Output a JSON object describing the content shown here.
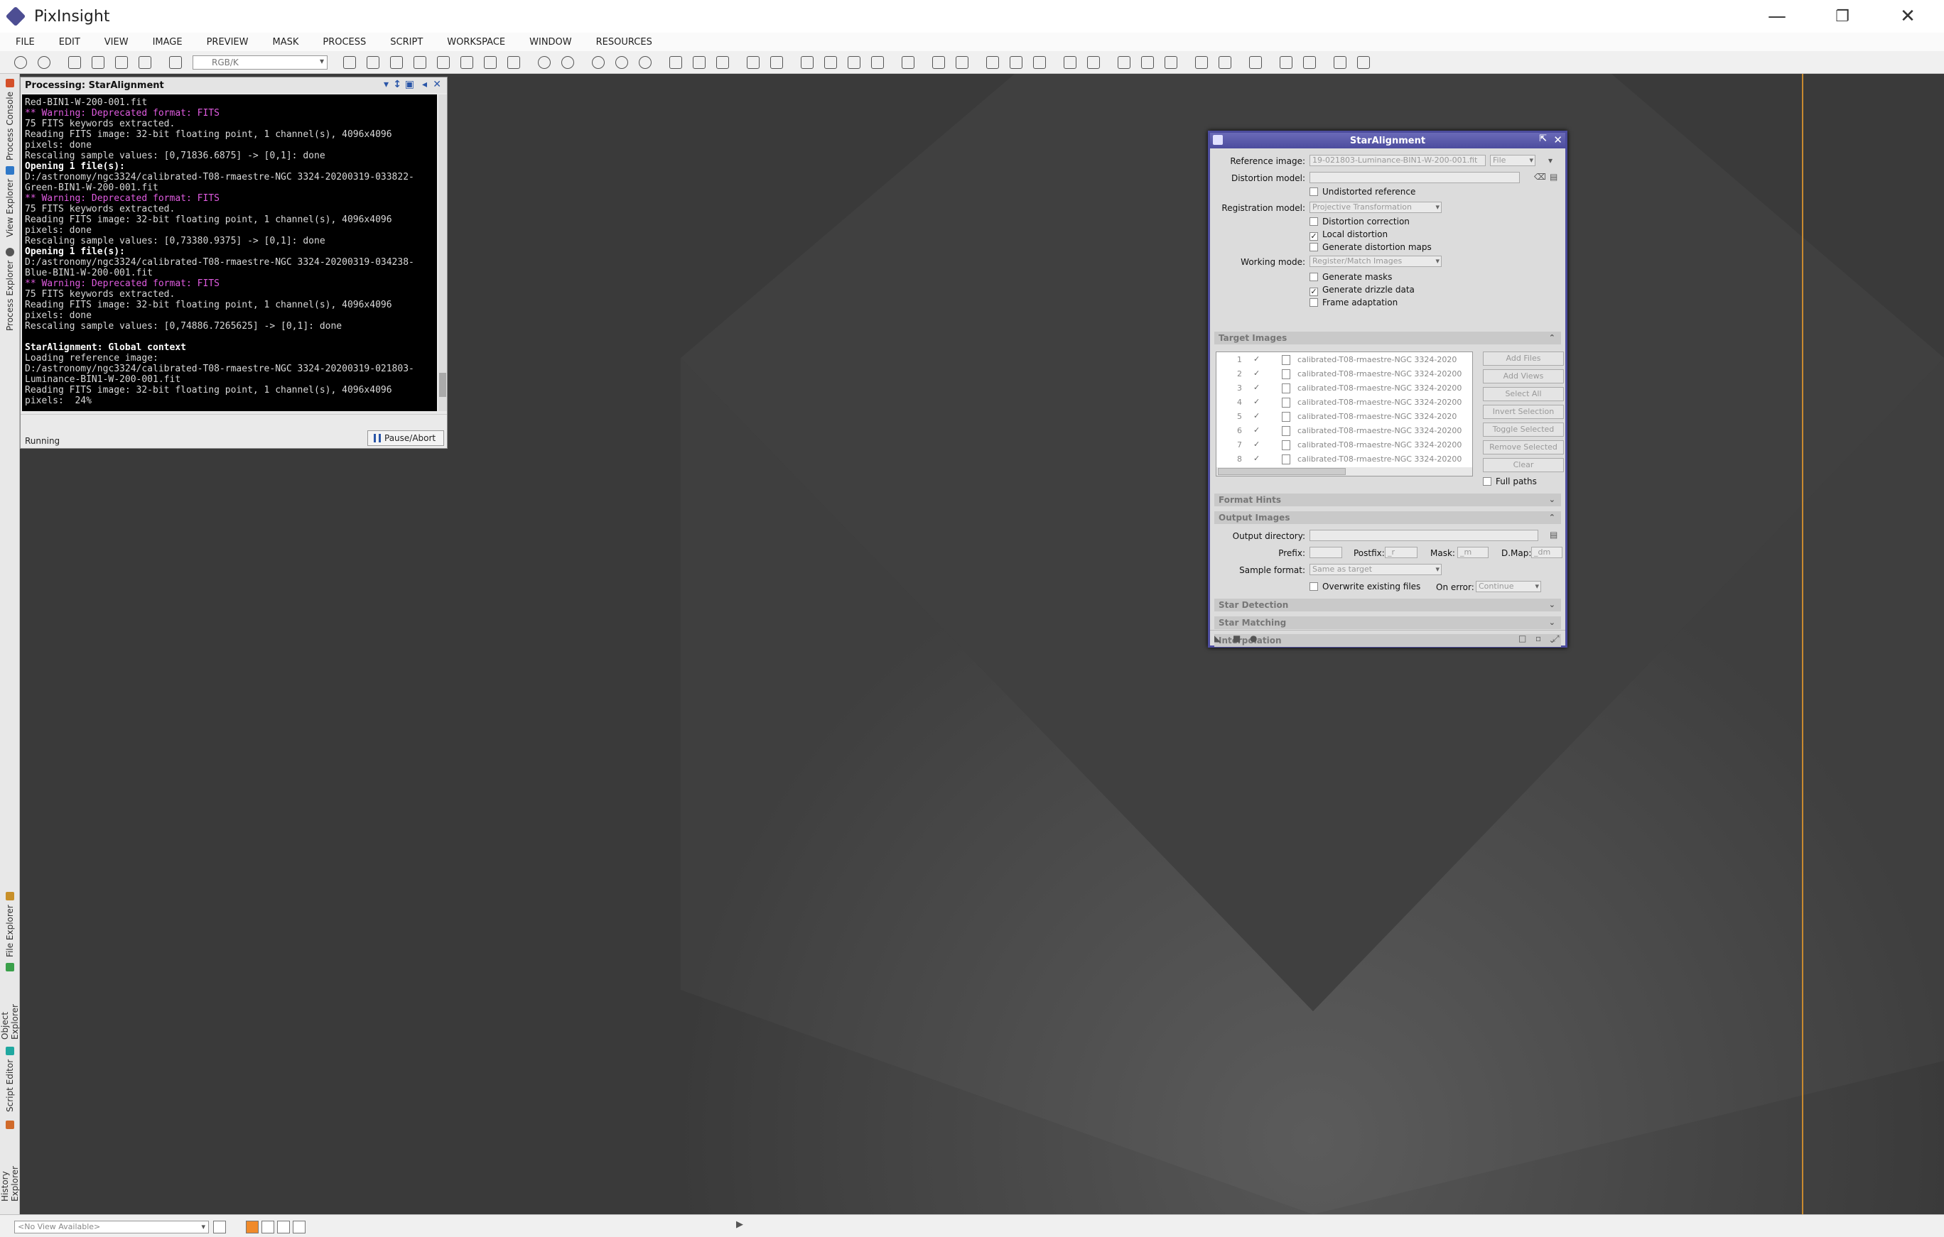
{
  "app": {
    "title": "PixInsight",
    "win_min": "—",
    "win_restore": "❐",
    "win_close": "✕"
  },
  "menu": [
    "FILE",
    "EDIT",
    "VIEW",
    "IMAGE",
    "PREVIEW",
    "MASK",
    "PROCESS",
    "SCRIPT",
    "WORKSPACE",
    "WINDOW",
    "RESOURCES"
  ],
  "toolbar": {
    "rgb_combo": "RGB/K"
  },
  "sidebar": {
    "tabs": [
      "Process Console",
      "View Explorer",
      "Process Explorer",
      "File Explorer",
      "Object Explorer",
      "Script Editor",
      "History Explorer"
    ]
  },
  "console": {
    "title": "Processing: StarAlignment",
    "lines": [
      {
        "t": "Red-BIN1-W-200-001.fit",
        "s": ""
      },
      {
        "t": "** Warning: Deprecated format: FITS",
        "s": "m"
      },
      {
        "t": "75 FITS keywords extracted.",
        "s": ""
      },
      {
        "t": "Reading FITS image: 32-bit floating point, 1 channel(s), 4096x4096",
        "s": ""
      },
      {
        "t": "pixels: done",
        "s": ""
      },
      {
        "t": "Rescaling sample values: [0,71836.6875] -> [0,1]: done",
        "s": ""
      },
      {
        "t": "Opening 1 file(s):",
        "s": "b"
      },
      {
        "t": "D:/astronomy/ngc3324/calibrated-T08-rmaestre-NGC 3324-20200319-033822-",
        "s": ""
      },
      {
        "t": "Green-BIN1-W-200-001.fit",
        "s": ""
      },
      {
        "t": "** Warning: Deprecated format: FITS",
        "s": "m"
      },
      {
        "t": "75 FITS keywords extracted.",
        "s": ""
      },
      {
        "t": "Reading FITS image: 32-bit floating point, 1 channel(s), 4096x4096",
        "s": ""
      },
      {
        "t": "pixels: done",
        "s": ""
      },
      {
        "t": "Rescaling sample values: [0,73380.9375] -> [0,1]: done",
        "s": ""
      },
      {
        "t": "Opening 1 file(s):",
        "s": "b"
      },
      {
        "t": "D:/astronomy/ngc3324/calibrated-T08-rmaestre-NGC 3324-20200319-034238-",
        "s": ""
      },
      {
        "t": "Blue-BIN1-W-200-001.fit",
        "s": ""
      },
      {
        "t": "** Warning: Deprecated format: FITS",
        "s": "m"
      },
      {
        "t": "75 FITS keywords extracted.",
        "s": ""
      },
      {
        "t": "Reading FITS image: 32-bit floating point, 1 channel(s), 4096x4096",
        "s": ""
      },
      {
        "t": "pixels: done",
        "s": ""
      },
      {
        "t": "Rescaling sample values: [0,74886.7265625] -> [0,1]: done",
        "s": ""
      },
      {
        "t": "",
        "s": ""
      },
      {
        "t": "StarAlignment: Global context",
        "s": "b"
      },
      {
        "t": "Loading reference image:",
        "s": ""
      },
      {
        "t": "D:/astronomy/ngc3324/calibrated-T08-rmaestre-NGC 3324-20200319-021803-",
        "s": ""
      },
      {
        "t": "Luminance-BIN1-W-200-001.fit",
        "s": ""
      },
      {
        "t": "Reading FITS image: 32-bit floating point, 1 channel(s), 4096x4096",
        "s": ""
      },
      {
        "t": "pixels:  24%",
        "s": ""
      }
    ],
    "status": "Running",
    "pause_label": "Pause/Abort"
  },
  "star_alignment": {
    "title": "StarAlignment",
    "reference_image_label": "Reference image:",
    "reference_image_value": "19-021803-Luminance-BIN1-W-200-001.fit",
    "reference_mode": "File",
    "distortion_model_label": "Distortion model:",
    "distortion_model_value": "",
    "undistorted_reference": "Undistorted reference",
    "registration_model_label": "Registration model:",
    "registration_model_value": "Projective Transformation",
    "distortion_correction": "Distortion correction",
    "local_distortion": "Local distortion",
    "generate_distortion_maps": "Generate distortion maps",
    "working_mode_label": "Working mode:",
    "working_mode_value": "Register/Match Images",
    "generate_masks": "Generate masks",
    "generate_drizzle": "Generate drizzle data",
    "frame_adaptation": "Frame adaptation",
    "checks": {
      "undistorted": false,
      "distortion_correction": false,
      "local_distortion": true,
      "distortion_maps": false,
      "masks": false,
      "drizzle": true,
      "frame_adaptation": false,
      "full_paths": false,
      "overwrite": false
    },
    "target_images_section": "Target Images",
    "targets": [
      {
        "n": "1",
        "name": "calibrated-T08-rmaestre-NGC 3324-2020"
      },
      {
        "n": "2",
        "name": "calibrated-T08-rmaestre-NGC 3324-20200"
      },
      {
        "n": "3",
        "name": "calibrated-T08-rmaestre-NGC 3324-20200"
      },
      {
        "n": "4",
        "name": "calibrated-T08-rmaestre-NGC 3324-20200"
      },
      {
        "n": "5",
        "name": "calibrated-T08-rmaestre-NGC 3324-2020"
      },
      {
        "n": "6",
        "name": "calibrated-T08-rmaestre-NGC 3324-20200"
      },
      {
        "n": "7",
        "name": "calibrated-T08-rmaestre-NGC 3324-20200"
      },
      {
        "n": "8",
        "name": "calibrated-T08-rmaestre-NGC 3324-20200"
      }
    ],
    "target_buttons": [
      "Add Files",
      "Add Views",
      "Select All",
      "Invert Selection",
      "Toggle Selected",
      "Remove Selected",
      "Clear"
    ],
    "full_paths": "Full paths",
    "format_hints_section": "Format Hints",
    "output_images_section": "Output Images",
    "output_directory_label": "Output directory:",
    "output_directory_value": "",
    "prefix_label": "Prefix:",
    "prefix_value": "",
    "postfix_label": "Postfix:",
    "postfix_value": "_r",
    "mask_label": "Mask:",
    "mask_value": "_m",
    "dmap_label": "D.Map:",
    "dmap_value": "_dm",
    "sample_format_label": "Sample format:",
    "sample_format_value": "Same as target",
    "overwrite_label": "Overwrite existing files",
    "on_error_label": "On error:",
    "on_error_value": "Continue",
    "star_detection_section": "Star Detection",
    "star_matching_section": "Star Matching",
    "interpolation_section": "Interpolation"
  },
  "bottom": {
    "no_view": "<No View Available>"
  }
}
